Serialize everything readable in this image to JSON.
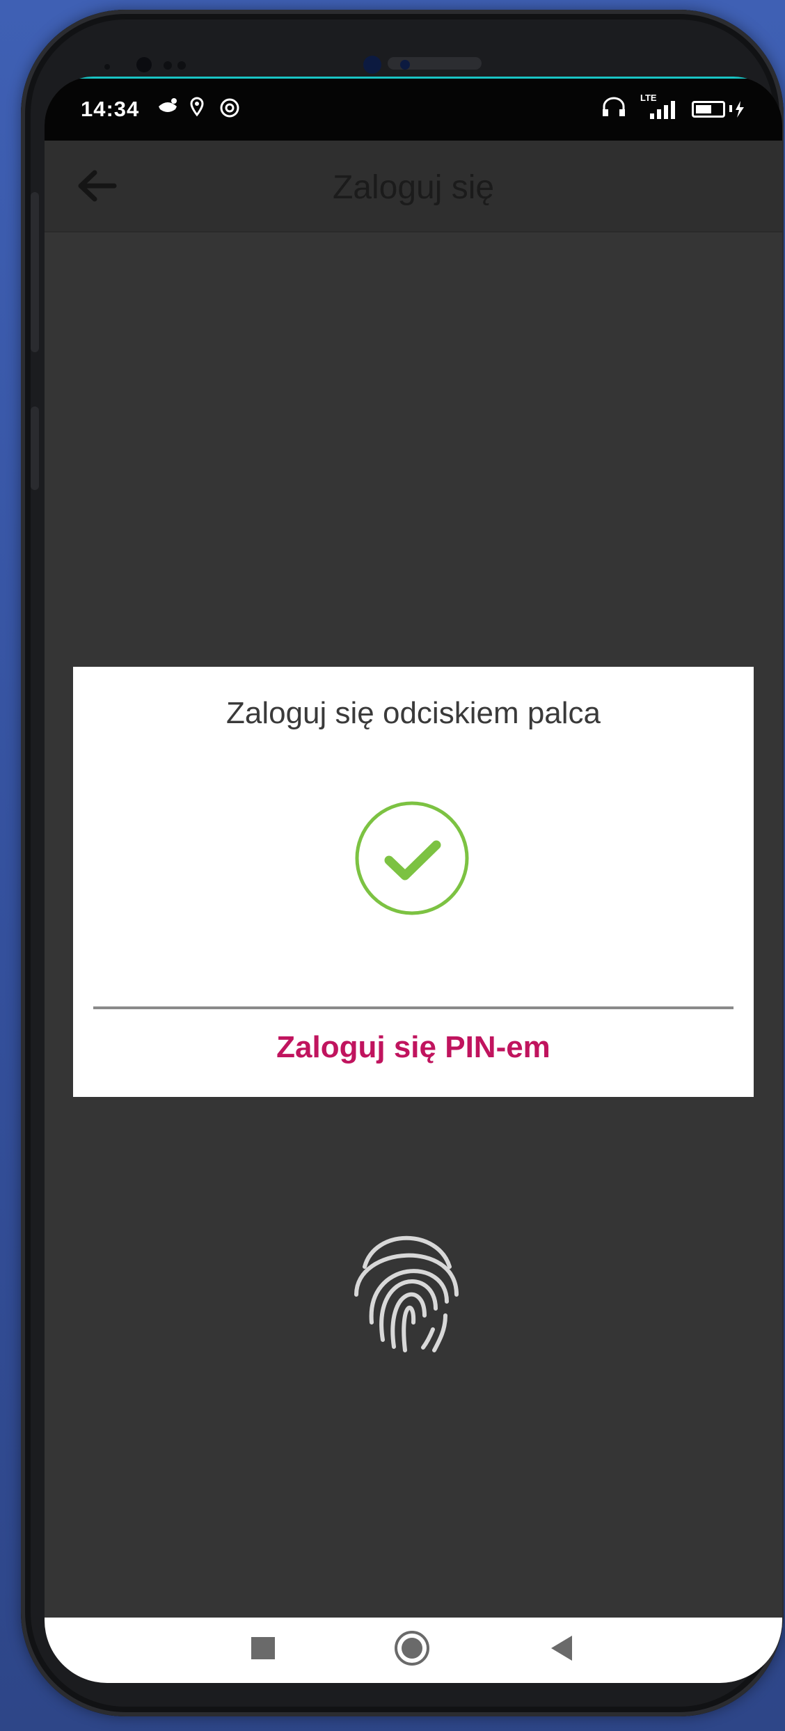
{
  "status_bar": {
    "time": "14:34",
    "network_label": "LTE",
    "battery_level": 0.6
  },
  "toolbar": {
    "back_icon": "arrow-left-icon",
    "title": "Zaloguj się"
  },
  "dialog": {
    "title": "Zaloguj się odciskiem palca",
    "status_icon": "check-circle-icon",
    "pin_link_label": "Zaloguj się PIN-em"
  },
  "fingerprint": {
    "icon": "fingerprint-icon"
  },
  "navbar": {
    "recent_icon": "square-icon",
    "home_icon": "circle-icon",
    "back_icon": "triangle-back-icon"
  },
  "colors": {
    "accent_pin": "#c0145e",
    "check_green": "#7cc242",
    "status_bar_border": "#19c3c3",
    "app_background": "#353535"
  }
}
